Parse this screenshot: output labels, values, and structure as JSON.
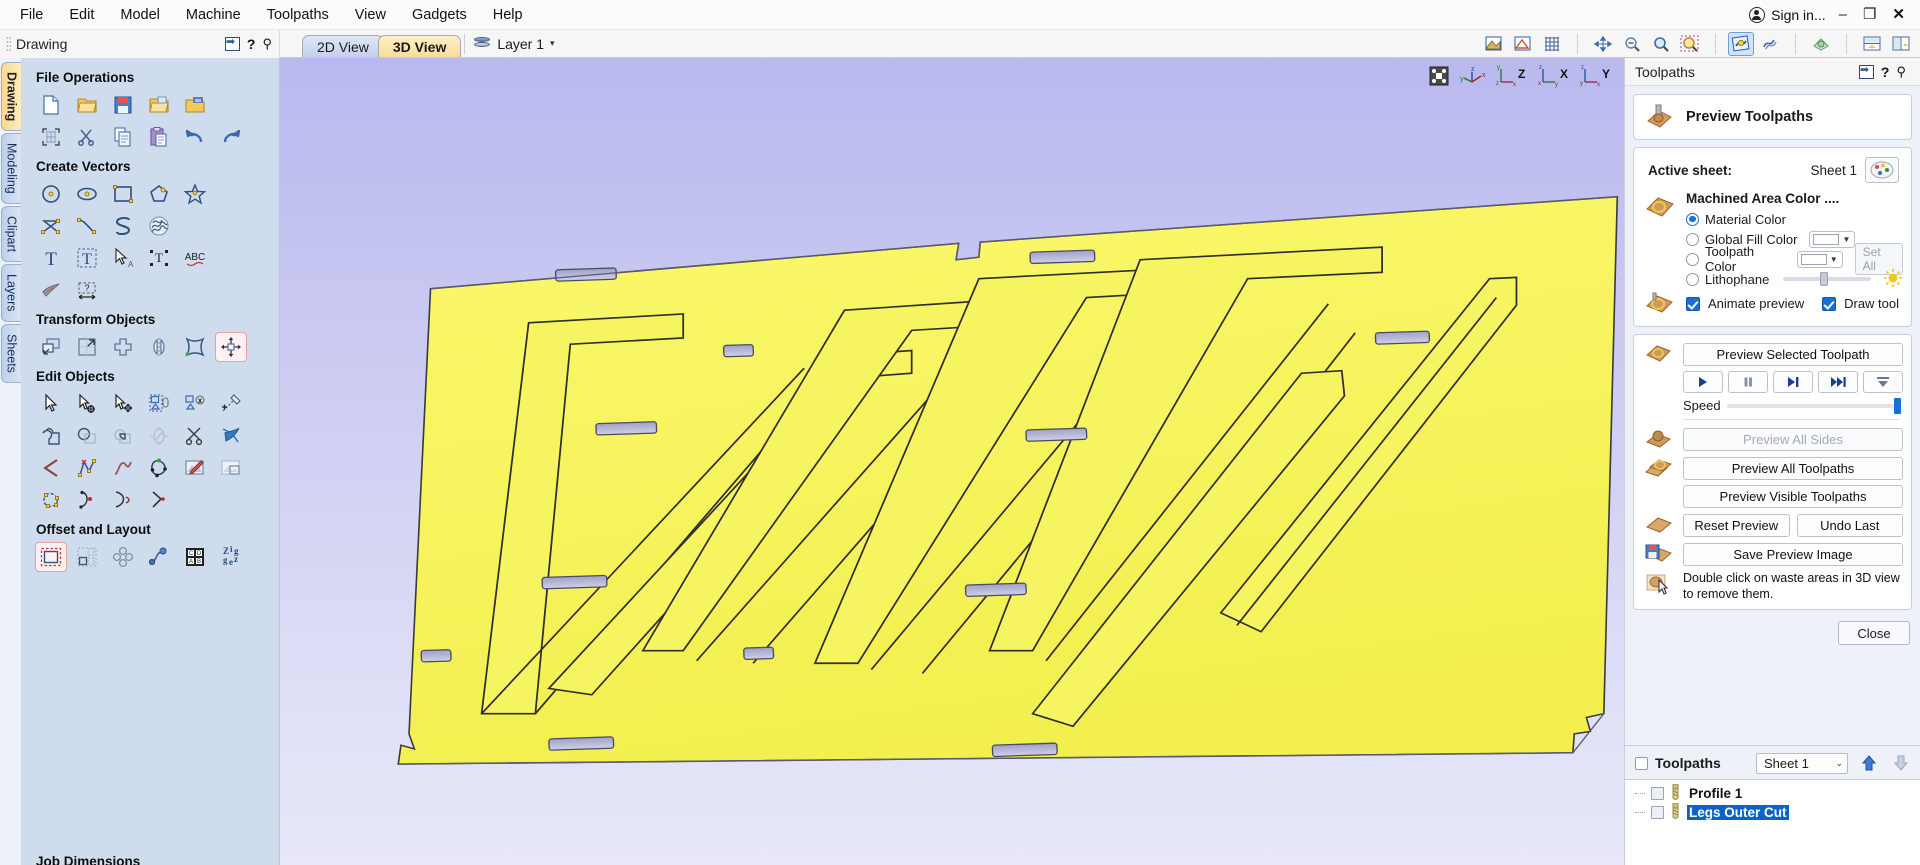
{
  "titlebar": {
    "menus": [
      "File",
      "Edit",
      "Model",
      "Machine",
      "Toolpaths",
      "View",
      "Gadgets",
      "Help"
    ],
    "sign_in": "Sign in...",
    "minimize": "–",
    "maximize": "❐",
    "close": "✕"
  },
  "left_dock": {
    "caption": "Drawing",
    "help_glyph": "?",
    "pin_glyph": "⚲",
    "tabs": [
      {
        "label": "Drawing",
        "active": true
      },
      {
        "label": "Modeling",
        "active": false
      },
      {
        "label": "Clipart",
        "active": false
      },
      {
        "label": "Layers",
        "active": false
      },
      {
        "label": "Sheets",
        "active": false
      }
    ],
    "groups": [
      {
        "title": "File Operations",
        "icons": [
          [
            "new-file-icon",
            "open-folder-icon",
            "save-icon",
            "open-recent-icon",
            "import-icon"
          ],
          [
            "job-setup-icon",
            "cut-icon",
            "copy-icon",
            "paste-icon",
            "undo-icon",
            "redo-icon"
          ]
        ]
      },
      {
        "title": "Create Vectors",
        "icons": [
          [
            "circle-icon",
            "ellipse-icon",
            "rectangle-icon",
            "polygon-icon",
            "star-icon"
          ],
          [
            "polyline-icon",
            "bezier-curve-icon",
            "draw-curve-icon",
            "texture-icon"
          ],
          [
            "create-text-icon",
            "text-box-icon",
            "select-text-icon",
            "text-on-curve-icon",
            "text-spellcheck-icon"
          ],
          [
            "trace-bitmap-icon",
            "dimension-icon"
          ]
        ]
      },
      {
        "title": "Transform Objects",
        "icons": [
          [
            "move-icon",
            "scale-icon",
            "align-icon",
            "mirror-icon",
            "distort-icon",
            "rotate-icon"
          ]
        ]
      },
      {
        "title": "Edit Objects",
        "icons": [
          [
            "select-arrow-icon",
            "node-edit-icon",
            "move-node-icon",
            "group-icon",
            "ungroup-icon",
            "measure-icon"
          ],
          [
            "weld-icon",
            "subtract-icon",
            "intersect-icon",
            "trim-icon",
            "scissors-icon",
            "join-icon"
          ],
          [
            "fillet-icon",
            "node-tools-icon",
            "smooth-curve-icon",
            "close-vector-icon",
            "edit-bitmap-icon",
            "crop-bitmap-icon"
          ],
          [
            "offset-nodes-icon",
            "start-point-icon",
            "curve-fit-icon",
            "insert-node-icon"
          ]
        ]
      },
      {
        "title": "Offset and Layout",
        "icons": [
          [
            "offset-vectors-icon",
            "nesting-icon",
            "array-copy-icon",
            "block-copy-icon",
            "plate-layout-icon",
            "zigzag-icon"
          ]
        ]
      }
    ],
    "footer_label": "Job Dimensions"
  },
  "view_tabs": {
    "tabs": [
      {
        "label": "2D View",
        "active": false
      },
      {
        "label": "3D View",
        "active": true
      }
    ],
    "layer": {
      "label": "Layer 1",
      "caret": "▾"
    }
  },
  "view_toolbar": {
    "icons": [
      "shade-3d-icon",
      "outline-3d-icon",
      "grid-icon",
      "pan-icon",
      "zoom-out-icon",
      "zoom-window-icon",
      "zoom-extents-icon",
      "toolpath-preview-icon",
      "toolpath-draw-icon",
      "material-icon",
      "two-view-split-icon",
      "side-view-split-icon"
    ],
    "selected": "toolpath-preview-icon"
  },
  "viewport": {
    "gizmos": [
      "iso-box-icon",
      "iso-view-icon",
      "z-view-icon",
      "x-view-icon",
      "y-view-icon"
    ],
    "material_color": "#f7f461",
    "background_top": "#b9b9ef",
    "background_bottom": "#e8e8fa"
  },
  "right_dock": {
    "caption": "Toolpaths",
    "help_glyph": "?",
    "pin_glyph": "⚲",
    "header": {
      "title": "Preview Toolpaths",
      "icon": "toolpath-preview-icon"
    },
    "active_sheet": {
      "label": "Active sheet:",
      "value": "Sheet 1",
      "palette_icon": "palette-icon"
    },
    "machined_area": {
      "title": "Machined Area Color ....",
      "icon": "machined-color-icon",
      "options": [
        {
          "label": "Material Color",
          "selected": true,
          "control": "none"
        },
        {
          "label": "Global Fill Color",
          "selected": false,
          "control": "color"
        },
        {
          "label": "Toolpath Color",
          "selected": false,
          "control": "color",
          "button": "Set All"
        },
        {
          "label": "Lithophane",
          "selected": false,
          "control": "slider"
        }
      ],
      "checkboxes": [
        {
          "label": "Animate preview",
          "checked": true
        },
        {
          "label": "Draw tool",
          "checked": true
        }
      ]
    },
    "preview": {
      "selected_toolpath_button": "Preview Selected Toolpath",
      "transport": [
        "play-icon",
        "pause-icon",
        "step-forward-icon",
        "fast-forward-icon",
        "skip-to-end-icon"
      ],
      "speed_label": "Speed",
      "speed_value": 100,
      "all_sides_button": "Preview All Sides",
      "all_sides_enabled": false,
      "all_toolpaths_button": "Preview All Toolpaths",
      "visible_toolpaths_button": "Preview Visible Toolpaths",
      "reset_button": "Reset Preview",
      "undo_button": "Undo Last",
      "save_image_button": "Save Preview Image",
      "hint": "Double click on waste areas in 3D view to remove them."
    },
    "close_button": "Close",
    "toolpath_list": {
      "title": "Toolpaths",
      "sheet_value": "Sheet 1",
      "sheet_caret": "⌄",
      "move_up_icon": "arrow-up-icon",
      "move_down_icon": "arrow-down-icon",
      "items": [
        {
          "name": "Profile 1",
          "checked": false,
          "selected": false
        },
        {
          "name": "Legs Outer Cut",
          "checked": false,
          "selected": true
        }
      ]
    }
  }
}
